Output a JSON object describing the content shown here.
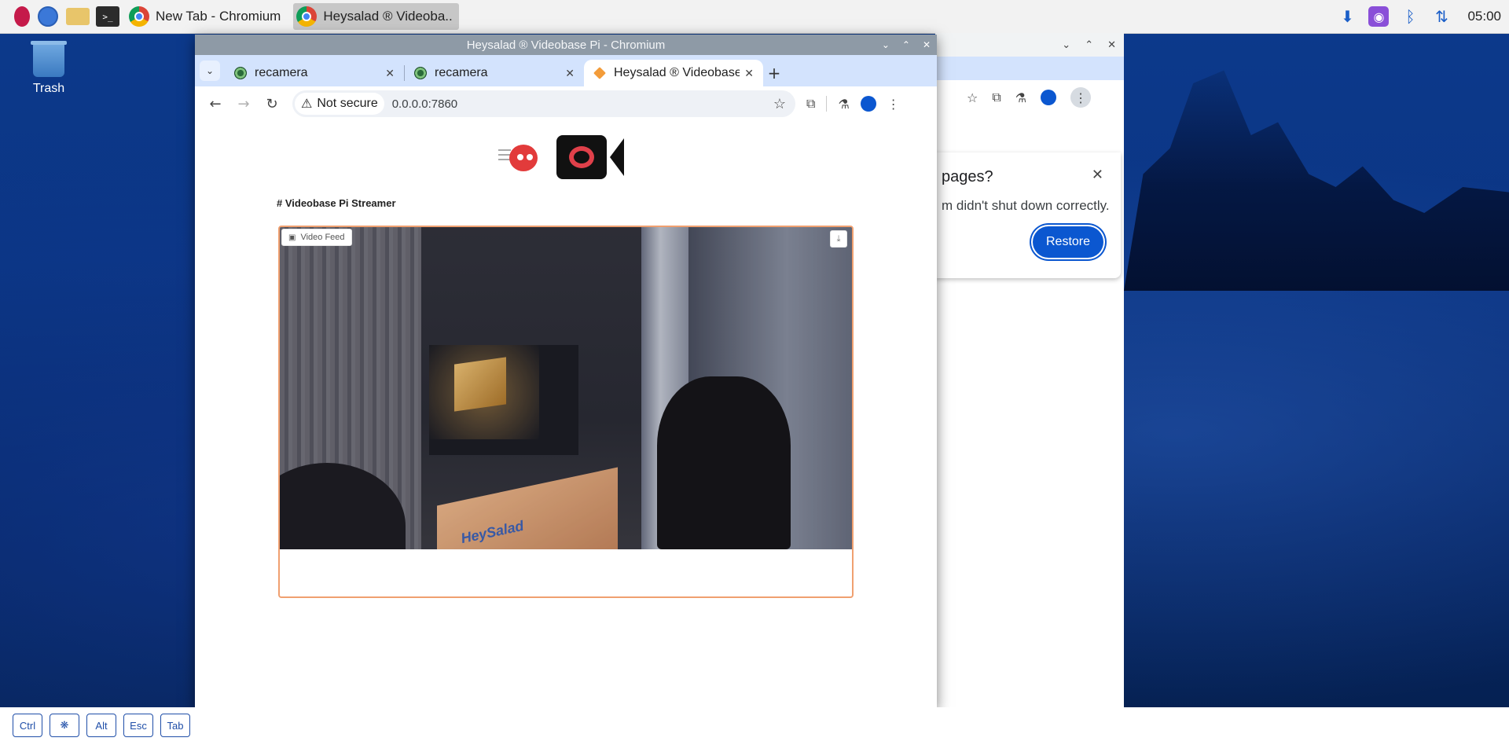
{
  "taskbar": {
    "tasks": [
      {
        "label": "New Tab - Chromium"
      },
      {
        "label": "Heysalad ® Videoba.."
      }
    ],
    "clock": "05:00",
    "terminal_glyph": ">_"
  },
  "desktop": {
    "trash_label": "Trash"
  },
  "background_window": {
    "restore_title": "pages?",
    "restore_message": "m didn't shut down correctly.",
    "restore_button": "Restore",
    "close_glyph": "✕"
  },
  "window": {
    "title": "Heysalad ® Videobase Pi - Chromium",
    "tabs": [
      {
        "label": "recamera"
      },
      {
        "label": "recamera"
      },
      {
        "label": "Heysalad ® Videobase P"
      }
    ],
    "new_tab_glyph": "+",
    "security_label": "Not secure",
    "url": "0.0.0.0:7860"
  },
  "page": {
    "heading": "# Videobase Pi Streamer",
    "feed_label": "Video Feed",
    "video_brand_text": "HeySalad"
  },
  "keyboard": {
    "keys": [
      "Ctrl",
      "",
      "Alt",
      "Esc",
      "Tab"
    ]
  },
  "icons": {
    "back": "back-arrow-icon",
    "forward": "forward-arrow-icon",
    "reload": "reload-icon",
    "bookmark": "star-icon",
    "extensions": "puzzle-icon",
    "labs": "flask-icon",
    "menu": "kebab-menu-icon"
  },
  "colors": {
    "restore_button": "#0b57d0",
    "tabstrip": "#d3e3fd",
    "feed_border": "#f0a070"
  }
}
